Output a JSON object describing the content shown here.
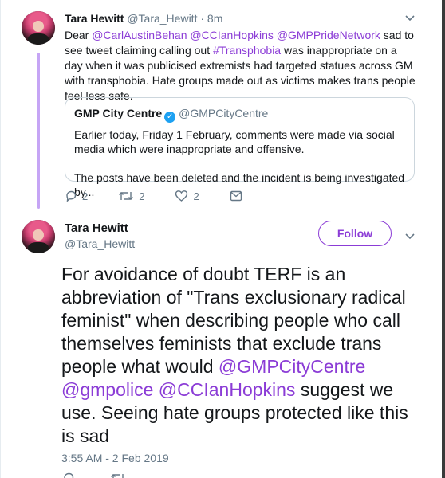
{
  "tweet1": {
    "name": "Tara Hewitt",
    "handle": "@Tara_Hewitt",
    "separator": " · ",
    "time": "8m",
    "text_parts": [
      {
        "t": "Dear ",
        "link": false
      },
      {
        "t": "@CarlAustinBehan",
        "link": true
      },
      {
        "t": " ",
        "link": false
      },
      {
        "t": "@CCIanHopkins",
        "link": true
      },
      {
        "t": " ",
        "link": false
      },
      {
        "t": "@GMPPrideNetwork",
        "link": true
      },
      {
        "t": " sad to see tweet claiming calling out ",
        "link": false
      },
      {
        "t": "#Transphobia",
        "link": true
      },
      {
        "t": " was inappropriate on a day when it was publicised extremists had targeted statues across GM with transphobia. Hate groups made out as victims makes trans people feel less safe.",
        "link": false
      }
    ],
    "quote": {
      "name": "GMP City Centre",
      "verified_glyph": "✓",
      "handle": "@GMPCityCentre",
      "text1": "Earlier today, Friday 1 February, comments were made via social media which were inappropriate and offensive.",
      "text2": "The posts have been deleted and the incident is being investigated by..."
    },
    "actions": {
      "replies": "2",
      "retweets": "2",
      "likes": "2"
    }
  },
  "tweet2": {
    "name": "Tara Hewitt",
    "handle": "@Tara_Hewitt",
    "follow_label": "Follow",
    "text_parts": [
      {
        "t": "For avoidance of doubt TERF is an abbreviation of \"Trans exclusionary radical feminist\" when describing people who call themselves feminists that exclude trans people what would ",
        "link": false
      },
      {
        "t": "@GMPCityCentre",
        "link": true
      },
      {
        "t": " ",
        "link": false
      },
      {
        "t": "@gmpolice",
        "link": true
      },
      {
        "t": " ",
        "link": false
      },
      {
        "t": "@CCIanHopkins",
        "link": true
      },
      {
        "t": " suggest we use. Seeing hate groups protected like this is sad",
        "link": false
      }
    ],
    "timestamp": "3:55 AM - 2 Feb 2019",
    "actions": {
      "replies": "",
      "retweets": "",
      "likes": ""
    }
  },
  "icons": {
    "chevron": "chevron-down-icon",
    "reply": "reply-icon",
    "retweet": "retweet-icon",
    "like": "heart-icon",
    "dm": "envelope-icon"
  },
  "colors": {
    "link": "#8b3cd6",
    "thread_line": "#c6a5f5",
    "muted": "#657786",
    "verified": "#1da1f2"
  }
}
